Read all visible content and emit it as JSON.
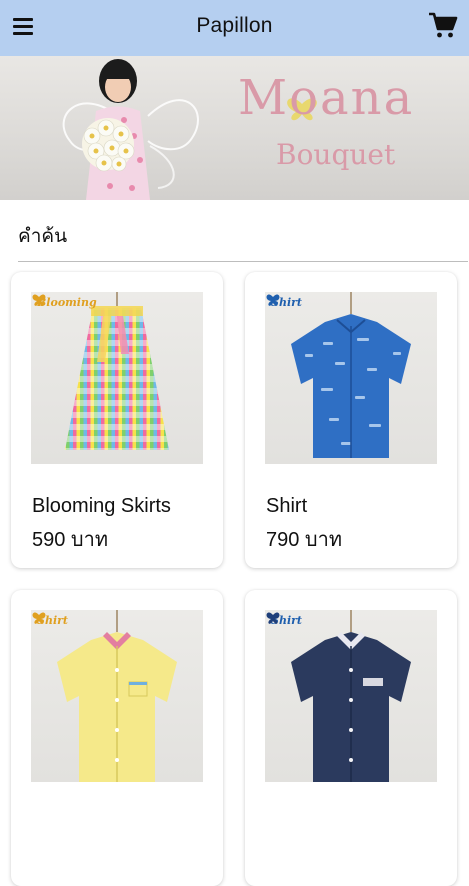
{
  "app_bar": {
    "title": "Papillon",
    "menu_icon": "hamburger-menu-icon",
    "cart_icon": "shopping-cart-icon"
  },
  "banner": {
    "brand_line1": "Moana",
    "brand_line2": "Bouquet"
  },
  "search": {
    "placeholder": "คำค้น"
  },
  "products": [
    {
      "name": "Blooming Skirts",
      "price": "590 บาท",
      "tag": "Blooming"
    },
    {
      "name": "Shirt",
      "price": "790 บาท",
      "tag": "Shirt"
    },
    {
      "name": "",
      "price": "",
      "tag": "Shirt"
    },
    {
      "name": "",
      "price": "",
      "tag": "Shirt"
    }
  ],
  "colors": {
    "app_bar": "#b5cff0",
    "brand_pink": "#d99aa8",
    "tag_gold": "#e0a020",
    "tag_blue": "#1f5fae"
  }
}
